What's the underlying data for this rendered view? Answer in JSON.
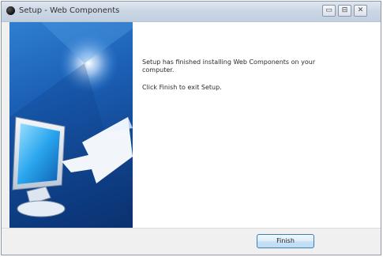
{
  "window": {
    "title": "Setup - Web Components",
    "icons": {
      "app": "setup-app-icon",
      "minimize": "minimize-icon",
      "maximize": "maximize-icon",
      "close": "close-icon"
    }
  },
  "content": {
    "message_line1": "Setup has finished installing Web Components on your",
    "message_line2": "computer.",
    "message_finish": "Click Finish to exit Setup."
  },
  "footer": {
    "finish_label": "Finish"
  },
  "colors": {
    "panel_blue": "#1b5fb5",
    "message_text": "#2a2a2a",
    "titlebar": "#cbd6e4"
  }
}
